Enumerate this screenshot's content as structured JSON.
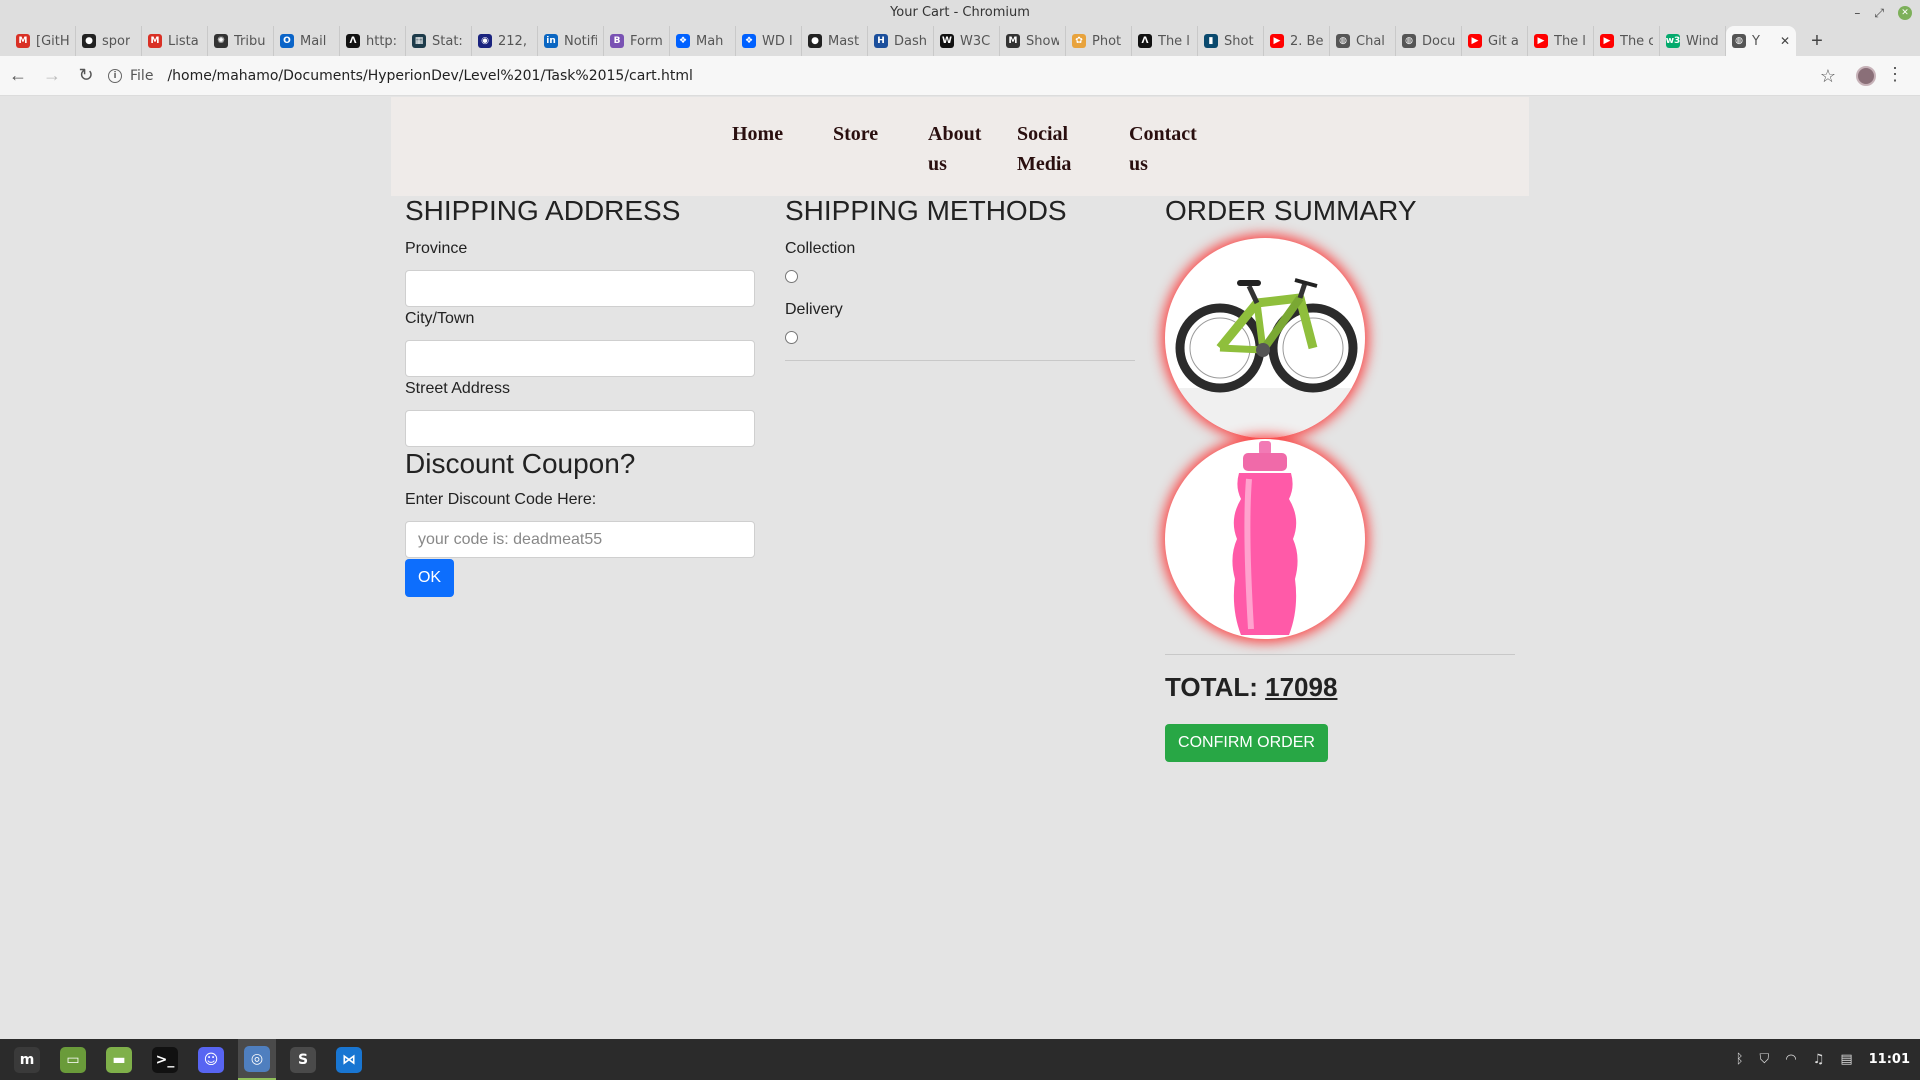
{
  "window": {
    "title": "Your Cart - Chromium",
    "minimize_glyph": "–",
    "maximize_glyph": "⤢",
    "close_glyph": "✕"
  },
  "tabs": [
    {
      "label": "[GitH",
      "icon": "gmail-icon",
      "color": "#d93025",
      "glyph": "M"
    },
    {
      "label": "spor",
      "icon": "github-icon",
      "color": "#222222",
      "glyph": "●"
    },
    {
      "label": "Lista",
      "icon": "gmail-icon",
      "color": "#d93025",
      "glyph": "M"
    },
    {
      "label": "Tribu",
      "icon": "openai-icon",
      "color": "#333333",
      "glyph": "✺"
    },
    {
      "label": "Mail",
      "icon": "outlook-icon",
      "color": "#0a64c8",
      "glyph": "O"
    },
    {
      "label": "http:",
      "icon": "notion-icon",
      "color": "#111111",
      "glyph": "Λ"
    },
    {
      "label": "Stat:",
      "icon": "stats-icon",
      "color": "#1d3b4a",
      "glyph": "▦"
    },
    {
      "label": "212,",
      "icon": "circle-icon",
      "color": "#1a237e",
      "glyph": "◉"
    },
    {
      "label": "Notifi",
      "icon": "linkedin-icon",
      "color": "#0a66c2",
      "glyph": "in"
    },
    {
      "label": "Form",
      "icon": "bootstrap-icon",
      "color": "#7952b3",
      "glyph": "B"
    },
    {
      "label": "Mah",
      "icon": "dropbox-icon",
      "color": "#0061ff",
      "glyph": "❖"
    },
    {
      "label": "WD l",
      "icon": "dropbox-icon",
      "color": "#0061ff",
      "glyph": "❖"
    },
    {
      "label": "Mast",
      "icon": "github-icon",
      "color": "#222222",
      "glyph": "●"
    },
    {
      "label": "Dash",
      "icon": "dashboard-icon",
      "color": "#1b4f9c",
      "glyph": "H"
    },
    {
      "label": "W3C",
      "icon": "w3c-icon",
      "color": "#111111",
      "glyph": "W"
    },
    {
      "label": "Show",
      "icon": "show-icon",
      "color": "#333333",
      "glyph": "M"
    },
    {
      "label": "Phot",
      "icon": "photos-icon",
      "color": "#e8a33d",
      "glyph": "✿"
    },
    {
      "label": "The l",
      "icon": "notion-icon",
      "color": "#111111",
      "glyph": "Λ"
    },
    {
      "label": "Shot",
      "icon": "shot-icon",
      "color": "#0a4a6e",
      "glyph": "▮"
    },
    {
      "label": "2. Be",
      "icon": "youtube-icon",
      "color": "#ff0000",
      "glyph": "▶"
    },
    {
      "label": "Chal",
      "icon": "globe-icon",
      "color": "#555555",
      "glyph": "◍"
    },
    {
      "label": "Docu",
      "icon": "globe-icon",
      "color": "#555555",
      "glyph": "◍"
    },
    {
      "label": "Git a",
      "icon": "youtube-icon",
      "color": "#ff0000",
      "glyph": "▶"
    },
    {
      "label": "The l",
      "icon": "youtube-icon",
      "color": "#ff0000",
      "glyph": "▶"
    },
    {
      "label": "The c",
      "icon": "youtube-icon",
      "color": "#ff0000",
      "glyph": "▶"
    },
    {
      "label": "Wind",
      "icon": "w3schools-icon",
      "color": "#04aa6d",
      "glyph": "w3"
    },
    {
      "label": "Y",
      "icon": "globe-icon",
      "color": "#555555",
      "glyph": "◍",
      "active": true
    }
  ],
  "toolbar": {
    "back": "←",
    "forward": "→",
    "reload": "↻",
    "scheme": "File",
    "url": "/home/mahamo/Documents/HyperionDev/Level%201/Task%2015/cart.html",
    "star": "☆",
    "menu": "⋮"
  },
  "nav": {
    "home": "Home",
    "store": "Store",
    "about_1": "About",
    "about_2": "us",
    "social_1": "Social",
    "social_2": "Media",
    "contact_1": "Contact",
    "contact_2": "us"
  },
  "shipping_address": {
    "heading": "SHIPPING ADDRESS",
    "province_label": "Province",
    "province_value": "",
    "city_label": "City/Town",
    "city_value": "",
    "street_label": "Street Address",
    "street_value": ""
  },
  "discount": {
    "heading": "Discount Coupon?",
    "label": "Enter Discount Code Here:",
    "placeholder": "your code is: deadmeat55",
    "ok_label": "OK"
  },
  "shipping_methods": {
    "heading": "SHIPPING METHODS",
    "collection_label": "Collection",
    "delivery_label": "Delivery"
  },
  "order_summary": {
    "heading": "ORDER SUMMARY",
    "products": [
      {
        "name": "mountain bike"
      },
      {
        "name": "pink water bottle"
      }
    ],
    "total_label": "TOTAL: ",
    "total_value": "17098",
    "confirm_label": "CONFIRM ORDER"
  },
  "taskbar": {
    "apps": [
      {
        "name": "mint-menu-icon",
        "glyph": "m",
        "color": "#3a3a3a"
      },
      {
        "name": "desktop-icon",
        "glyph": "▭",
        "color": "#6a9b3a"
      },
      {
        "name": "files-icon",
        "glyph": "▬",
        "color": "#7fb04a"
      },
      {
        "name": "terminal-icon",
        "glyph": ">_",
        "color": "#111111"
      },
      {
        "name": "discord-icon",
        "glyph": "☺",
        "color": "#5865f2"
      },
      {
        "name": "chromium-icon",
        "glyph": "◎",
        "color": "#4f7fbf",
        "active": true
      },
      {
        "name": "sublime-icon",
        "glyph": "S",
        "color": "#4a4a4a"
      },
      {
        "name": "vscode-icon",
        "glyph": "⋈",
        "color": "#1976d2"
      }
    ],
    "tray": {
      "bluetooth": "ᛒ",
      "shield": "⛉",
      "wifi": "◠",
      "music": "♫",
      "clipboard": "▤",
      "clock": "11:01"
    }
  }
}
